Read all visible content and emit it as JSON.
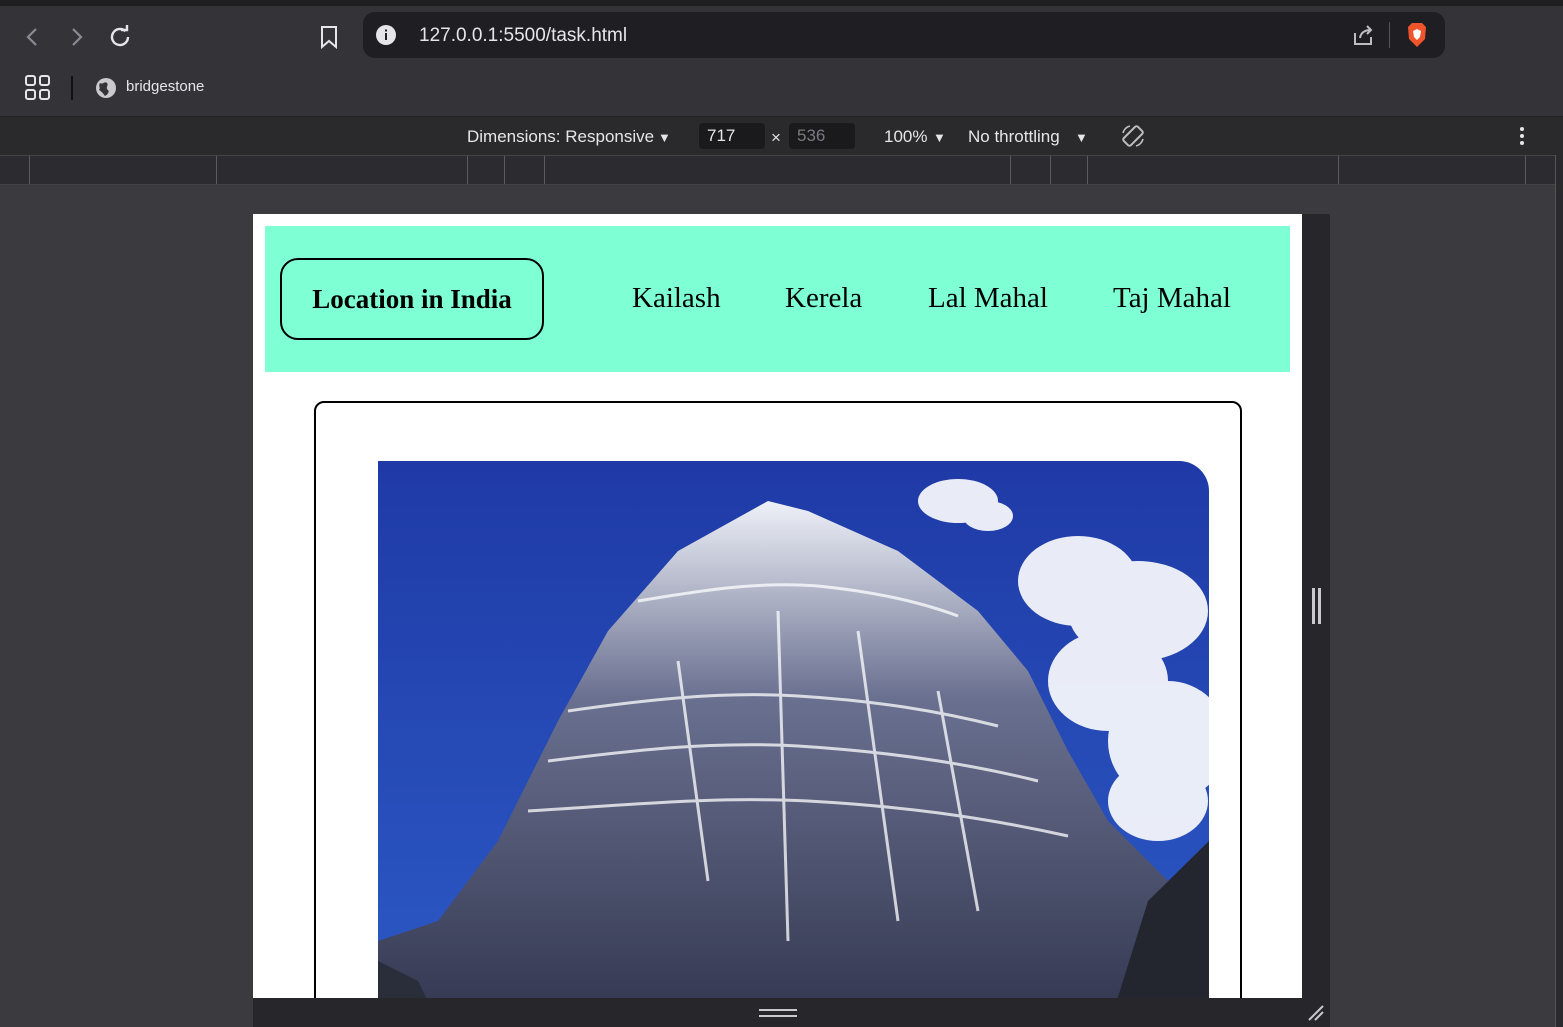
{
  "browser": {
    "url": "127.0.0.1:5500/task.html",
    "bookmark_label": "bridgestone"
  },
  "devtools": {
    "dimensions_label": "Dimensions: Responsive",
    "width_value": "717",
    "height_value": "536",
    "times": "×",
    "zoom_label": "100%",
    "throttling_label": "No throttling"
  },
  "page": {
    "logo_label": "Location in India",
    "nav": [
      "Kailash",
      "Kerela",
      "Lal Mahal",
      "Taj Mahal"
    ]
  },
  "colors": {
    "header_bg": "#7fffd4",
    "sky": "#1e3fae"
  }
}
